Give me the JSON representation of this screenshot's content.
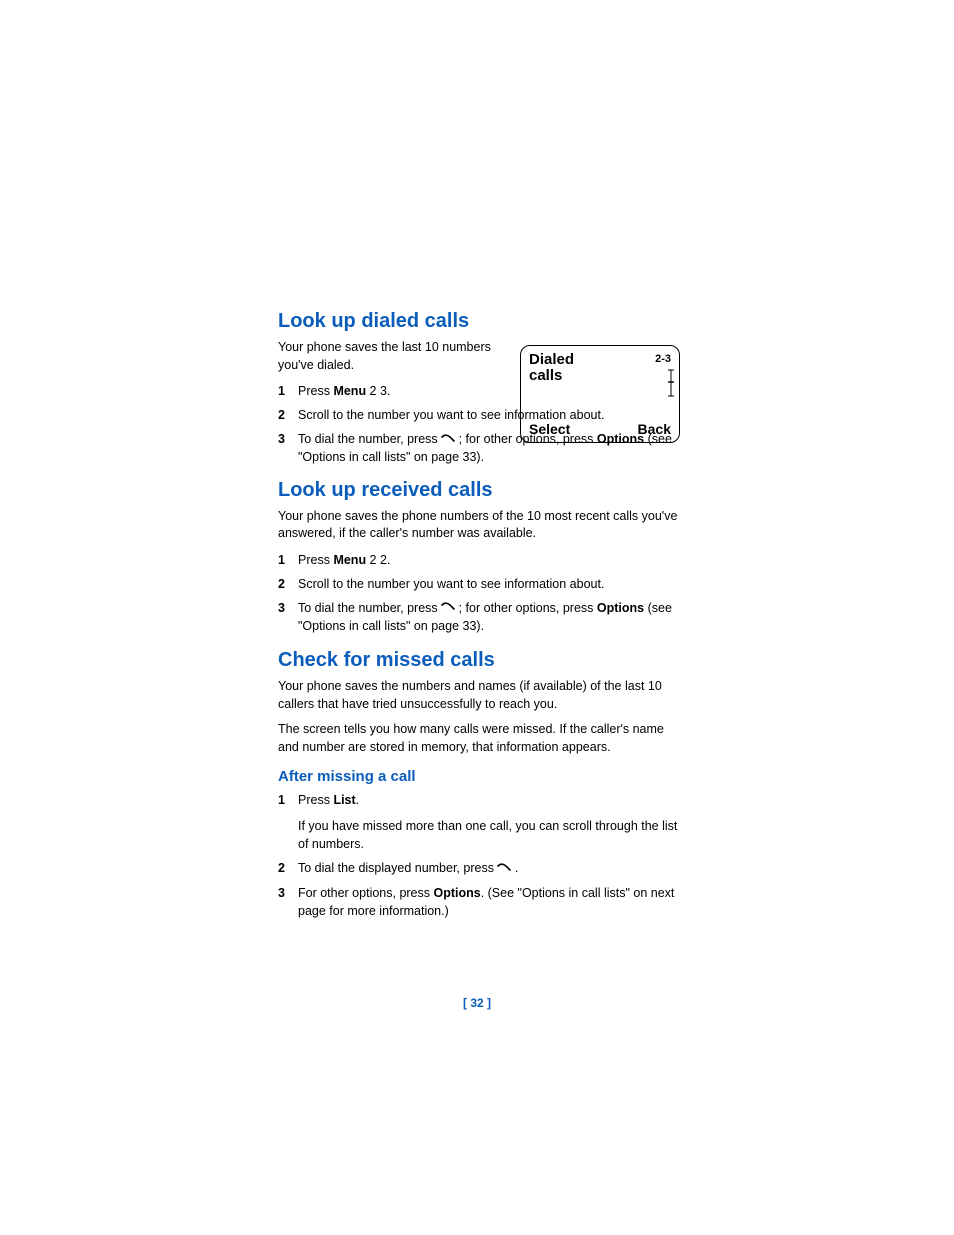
{
  "page_number": "[ 32 ]",
  "phone_screen": {
    "title_line1": "Dialed",
    "title_line2": "calls",
    "index": "2-3",
    "left_soft": "Select",
    "right_soft": "Back"
  },
  "s1": {
    "heading": "Look up dialed calls",
    "intro": "Your phone saves the last 10 numbers you've dialed.",
    "i1a": "Press ",
    "i1b": "Menu",
    "i1c": " 2 3.",
    "i2": "Scroll to the number you want to see information about.",
    "i3a": "To dial the number, press ",
    "i3b": " ; for other options, press ",
    "i3c": "Options",
    "i3d": " (see \"Options in call lists\" on page 33)."
  },
  "s2": {
    "heading": "Look up received calls",
    "intro": "Your phone saves the phone numbers of the 10 most recent calls you've answered, if the caller's number was available.",
    "i1a": "Press ",
    "i1b": "Menu",
    "i1c": " 2 2.",
    "i2": "Scroll to the number you want to see information about.",
    "i3a": "To dial the number, press ",
    "i3b": " ; for other options, press ",
    "i3c": "Options",
    "i3d": " (see \"Options in call lists\" on page 33)."
  },
  "s3": {
    "heading": "Check for missed calls",
    "p1": "Your phone saves the numbers and names (if available) of the last 10 callers that have tried unsuccessfully to reach you.",
    "p2": "The screen tells you how many calls were missed. If the caller's name and number are stored in memory, that information appears.",
    "sub_heading": "After missing a call",
    "i1a": "Press ",
    "i1b": "List",
    "i1c": ".",
    "i1_sub": "If you have missed more than one call, you can scroll through the list of numbers.",
    "i2a": "To dial the displayed number, press ",
    "i2b": " .",
    "i3a": "For other options, press ",
    "i3b": "Options",
    "i3c": ". (See \"Options in call lists\" on next page for more information.)"
  }
}
